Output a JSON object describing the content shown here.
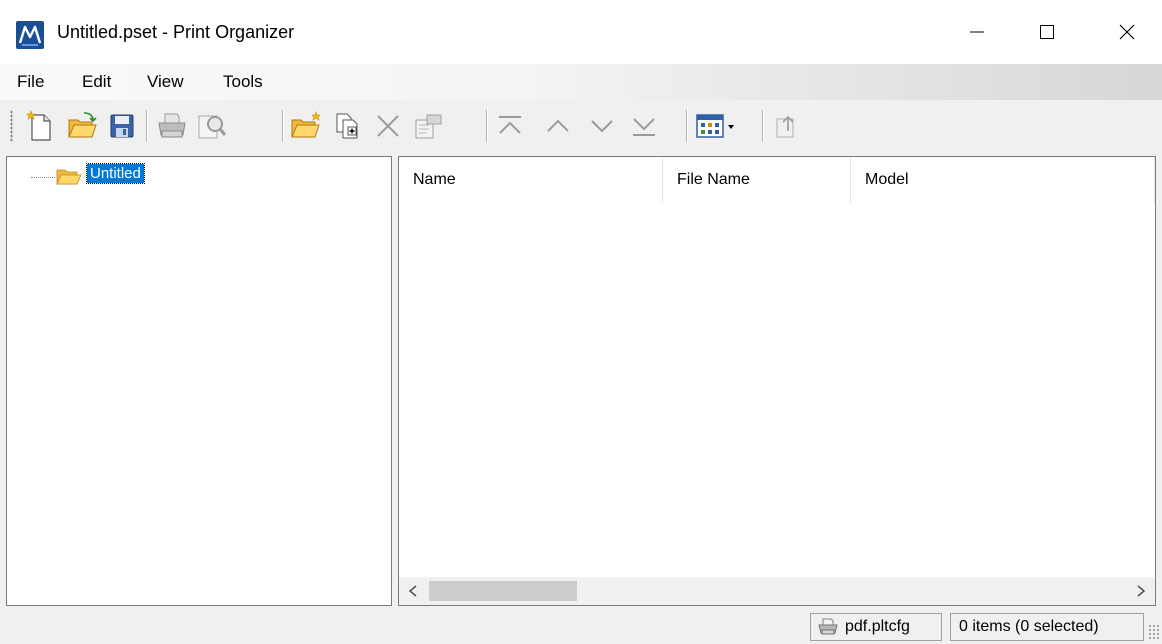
{
  "window": {
    "title": "Untitled.pset - Print Organizer",
    "controls": [
      "minimize",
      "maximize",
      "close"
    ]
  },
  "menu": {
    "items": [
      {
        "label": "File"
      },
      {
        "label": "Edit"
      },
      {
        "label": "View"
      },
      {
        "label": "Tools"
      }
    ]
  },
  "toolbar": {
    "buttons": [
      {
        "icon": "new-document-icon",
        "enabled": true
      },
      {
        "icon": "open-folder-icon",
        "enabled": true
      },
      {
        "icon": "save-icon",
        "enabled": true
      },
      {
        "icon": "print-icon",
        "enabled": false
      },
      {
        "icon": "preview-icon",
        "enabled": false
      },
      {
        "icon": "new-folder-icon",
        "enabled": true
      },
      {
        "icon": "add-files-icon",
        "enabled": true
      },
      {
        "icon": "delete-icon",
        "enabled": false
      },
      {
        "icon": "properties-icon",
        "enabled": false
      },
      {
        "icon": "move-top-icon",
        "enabled": false
      },
      {
        "icon": "move-up-icon",
        "enabled": false
      },
      {
        "icon": "move-down-icon",
        "enabled": false
      },
      {
        "icon": "move-bottom-icon",
        "enabled": false
      },
      {
        "icon": "view-options-icon",
        "enabled": true
      },
      {
        "icon": "export-icon",
        "enabled": false
      }
    ]
  },
  "tree": {
    "root_label": "Untitled",
    "selected": true
  },
  "list": {
    "columns": [
      {
        "label": "Name"
      },
      {
        "label": "File Name"
      },
      {
        "label": "Model"
      }
    ],
    "rows": []
  },
  "statusbar": {
    "printer": "pdf.pltcfg",
    "items": "0 items (0 selected)"
  },
  "colors": {
    "selection": "#0078d7",
    "brand": "#1b4f95",
    "folder": "#f5c84c"
  }
}
